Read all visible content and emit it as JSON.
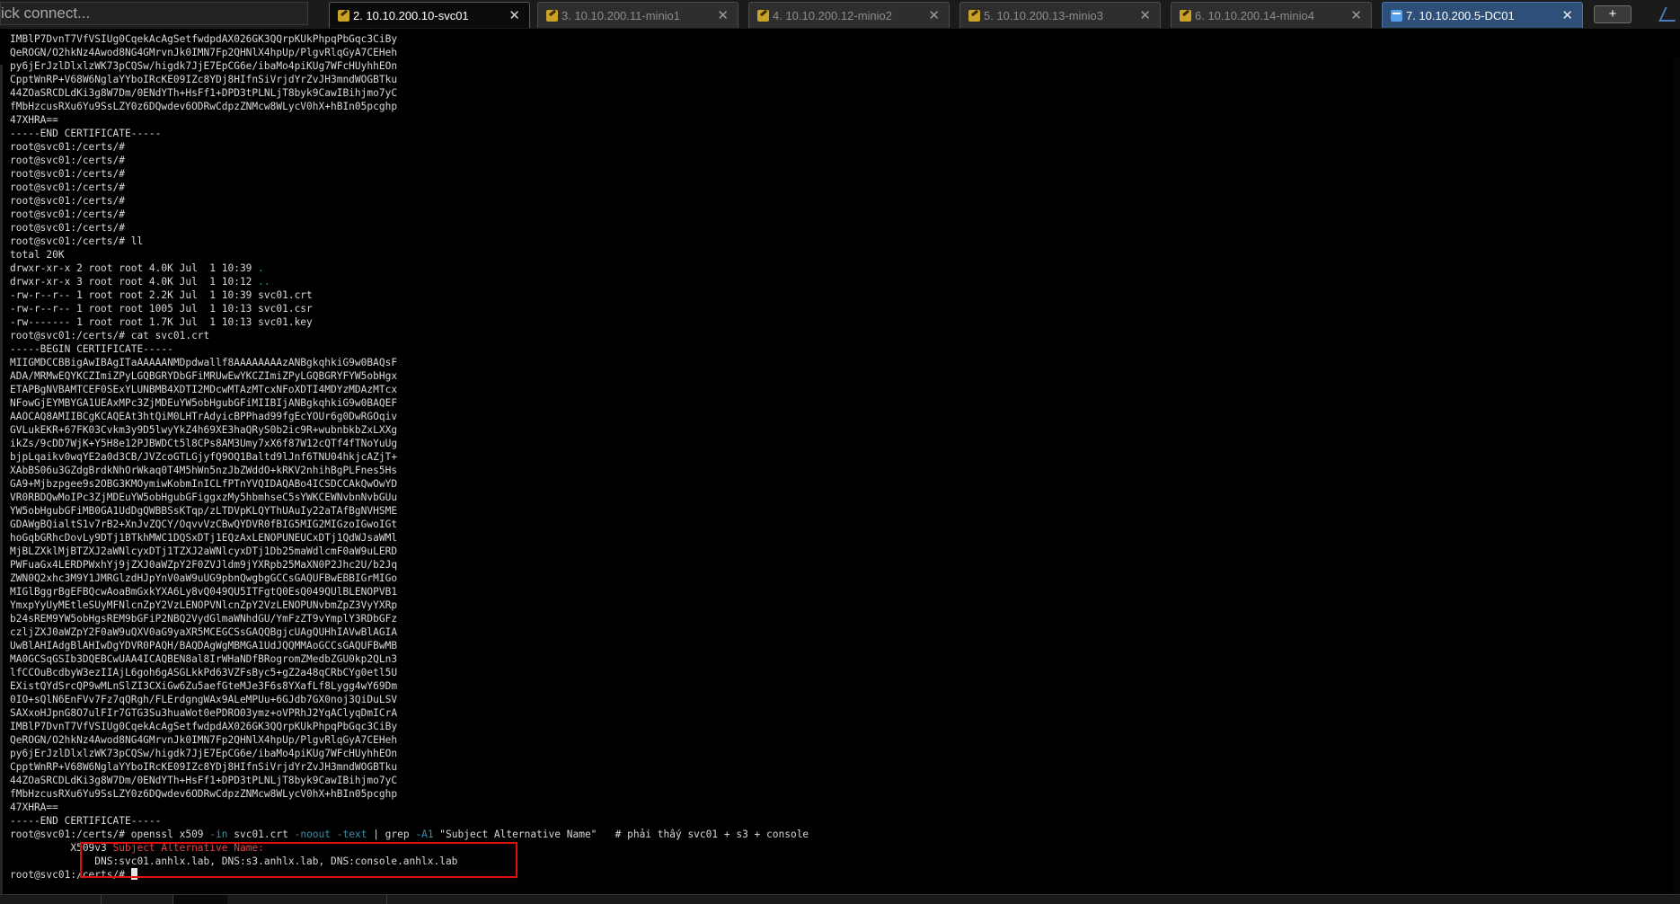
{
  "quick_connect": {
    "text": "ick connect..."
  },
  "tabs": [
    {
      "label": "2. 10.10.200.10-svc01",
      "close": "✕",
      "state": "active"
    },
    {
      "label": "3. 10.10.200.11-minio1",
      "close": "✕",
      "state": "inactive"
    },
    {
      "label": "4. 10.10.200.12-minio2",
      "close": "✕",
      "state": "inactive"
    },
    {
      "label": "5. 10.10.200.13-minio3",
      "close": "✕",
      "state": "inactive"
    },
    {
      "label": "6. 10.10.200.14-minio4",
      "close": "✕",
      "state": "inactive"
    },
    {
      "label": "7. 10.10.200.5-DC01",
      "close": "✕",
      "state": "selected"
    }
  ],
  "new_tab": {
    "label": "+"
  },
  "colors": {
    "highlight_box": "#e01010",
    "directory": "#3a8fa8",
    "option_flag": "#3a8fa8",
    "san_label": "#e04545",
    "selected_tab": "#2d4f78"
  },
  "icons": {
    "tab": "session-icon",
    "selected_tab": "rdp-icon",
    "corner": "network-icon"
  },
  "terminal": {
    "lines_top": [
      "IMBlP7DvnT7VfVSIUg0CqekAcAgSetfwdpdAX026GK3QQrpKUkPhpqPbGqc3CiBy",
      "QeROGN/O2hkNz4Awod8NG4GMrvnJk0IMN7Fp2QHNlX4hpUp/PlgvRlqGyA7CEHeh",
      "py6jErJzlDlxlzWK73pCQSw/higdk7JjE7EpCG6e/ibaMo4piKUg7WFcHUyhhEOn",
      "CpptWnRP+V68W6NglaYYboIRcKE09IZc8YDj8HIfnSiVrjdYrZvJH3mndWOGBTku",
      "44ZOaSRCDLdKi3g8W7Dm/0ENdYTh+HsFf1+DPD3tPLNLjT8byk9CawIBihjmo7yC",
      "fMbHzcusRXu6Yu9SsLZY0z6DQwdev6ODRwCdpzZNMcw8WLycV0hX+hBIn05pcghp",
      "47XHRA==",
      "-----END CERTIFICATE-----",
      "root@svc01:/certs/#",
      "root@svc01:/certs/#",
      "root@svc01:/certs/#",
      "root@svc01:/certs/#",
      "root@svc01:/certs/#",
      "root@svc01:/certs/#",
      "root@svc01:/certs/#",
      "root@svc01:/certs/# ll",
      "total 20K"
    ],
    "ls_rows": [
      {
        "text": "drwxr-xr-x 2 root root 4.0K Jul  1 10:39 ",
        "name": "."
      },
      {
        "text": "drwxr-xr-x 3 root root 4.0K Jul  1 10:12 ",
        "name": ".."
      },
      {
        "text": "-rw-r--r-- 1 root root 2.2K Jul  1 10:39 ",
        "name": "svc01.crt"
      },
      {
        "text": "-rw-r--r-- 1 root root 1005 Jul  1 10:13 ",
        "name": "svc01.csr"
      },
      {
        "text": "-rw------- 1 root root 1.7K Jul  1 10:13 ",
        "name": "svc01.key"
      }
    ],
    "lines_cert": [
      "root@svc01:/certs/# cat svc01.crt",
      "-----BEGIN CERTIFICATE-----",
      "MIIGMDCCBBigAwIBAgITaAAAAANMDpdwallf8AAAAAAAAzANBgkqhkiG9w0BAQsF",
      "ADA/MRMwEQYKCZImiZPyLGQBGRYDbGFiMRUwEwYKCZImiZPyLGQBGRYFYW5obHgx",
      "ETAPBgNVBAMTCEF0SExYLUNBMB4XDTI2MDcwMTAzMTcxNFoXDTI4MDYzMDAzMTcx",
      "NFowGjEYMBYGA1UEAxMPc3ZjMDEuYW5obHgubGFiMIIBIjANBgkqhkiG9w0BAQEF",
      "AAOCAQ8AMIIBCgKCAQEAt3htQiM0LHTrAdyicBPPhad99fgEcYOUr6g0DwRGOqiv",
      "GVLukEKR+67FK03Cvkm3y9D5lwyYkZ4h69XE3haQRyS0b2ic9R+wubnbkbZxLXXg",
      "ikZs/9cDD7WjK+Y5H8e12PJBWDCt5l8CPs8AM3Umy7xX6f87W12cQTf4fTNoYuUg",
      "bjpLqaikv0wqYE2a0d3CB/JVZcoGTLGjyfQ9OQ1Baltd9lJnf6TNU04hkjcAZjT+",
      "XAbBS06u3GZdgBrdkNhOrWkaq0T4M5hWn5nzJbZWddO+kRKV2nhihBgPLFnes5Hs",
      "GA9+Mjbzpgee9s2OBG3KMOymiwKobmInICLfPTnYVQIDAQABo4ICSDCCAkQwOwYD",
      "VR0RBDQwMoIPc3ZjMDEuYW5obHgubGFiggxzMy5hbmhseC5sYWKCEWNvbnNvbGUu",
      "YW5obHgubGFiMB0GA1UdDgQWBBSsKTqp/zLTDVpKLQYThUAuIy22aTAfBgNVHSME",
      "GDAWgBQialtS1v7rB2+XnJvZQCY/OqvvVzCBwQYDVR0fBIG5MIG2MIGzoIGwoIGt",
      "hoGqbGRhcDovLy9DTj1BTkhMWC1DQSxDTj1EQzAxLENOPUNEUCxDTj1QdWJsaWMl",
      "MjBLZXklMjBTZXJ2aWNlcyxDTj1TZXJ2aWNlcyxDTj1Db25maWdlcmF0aW9uLERD",
      "PWFuaGx4LERDPWxhYj9jZXJ0aWZpY2F0ZVJldm9jYXRpb25MaXN0P2Jhc2U/b2Jq",
      "ZWN0Q2xhc3M9Y1JMRGlzdHJpYnV0aW9uUG9pbnQwgbgGCCsGAQUFBwEBBIGrMIGo",
      "MIGlBggrBgEFBQcwAoaBmGxkYXA6Ly8vQ049QU5ITFgtQ0EsQ049QUlBLENOPVB1",
      "YmxpYyUyMEtleSUyMFNlcnZpY2VzLENOPVNlcnZpY2VzLENOPUNvbmZpZ3VyYXRp",
      "b24sREM9YW5obHgsREM9bGFiP2NBQ2VydGlmaWNhdGU/YmFzZT9vYmplY3RDbGFz",
      "czljZXJ0aWZpY2F0aW9uQXV0aG9yaXR5MCEGCSsGAQQBgjcUAgQUHhIAVwBlAGIA",
      "UwBlAHIAdgBlAHIwDgYDVR0PAQH/BAQDAgWgMBMGA1UdJQQMMAoGCCsGAQUFBwMB",
      "MA0GCSqGSIb3DQEBCwUAA4ICAQBEN8al8IrWHaNDfBRogromZMedbZGU0kp2QLn3",
      "lfCCOuBcdbyW3ezIIAjL6goh6gASGLkkPd63VZFsByc5+gZ2a48qCRbCYg0etl5U",
      "EXistQYdSrcQP9wMLnSlZI3CXiGw6Zu5aefGteMJe3F6s8YXafLf8Lygg4wY69Dm",
      "0IO+sQlN6EnFVv7Fz7qQRgh/FLErdgngWAx9ALeMPUu+6GJdb7GX0noj3QiDuLSV",
      "SAXxoHJpnG8O7ulFIr7GTG3Su3huaWot0ePDRO03ymz+oVPRhJ2YqAClyqDmICrA",
      "IMBlP7DvnT7VfVSIUg0CqekAcAgSetfwdpdAX026GK3QQrpKUkPhpqPbGqc3CiBy",
      "QeROGN/O2hkNz4Awod8NG4GMrvnJk0IMN7Fp2QHNlX4hpUp/PlgvRlqGyA7CEHeh",
      "py6jErJzlDlxlzWK73pCQSw/higdk7JjE7EpCG6e/ibaMo4piKUg7WFcHUyhhEOn",
      "CpptWnRP+V68W6NglaYYboIRcKE09IZc8YDj8HIfnSiVrjdYrZvJH3mndWOGBTku",
      "44ZOaSRCDLdKi3g8W7Dm/0ENdYTh+HsFf1+DPD3tPLNLjT8byk9CawIBihjmo7yC",
      "fMbHzcusRXu6Yu9SsLZY0z6DQwdev6ODRwCdpzZNMcw8WLycV0hX+hBIn05pcghp",
      "47XHRA==",
      "-----END CERTIFICATE-----"
    ],
    "openssl": {
      "prompt": "root@svc01:/certs/# ",
      "cmd1": "openssl x509 ",
      "opt1": "-in",
      "cmd2": " svc01.crt ",
      "opt2": "-noout",
      "sp1": " ",
      "opt3": "-text",
      "cmd3": " | grep ",
      "opt4": "-A1",
      "cmd4": " \"Subject Alternative Name\"   # phải thấy svc01 + s3 + console"
    },
    "san": {
      "prefix": "          X509v3 ",
      "label": "Subject Alternative Name:",
      "values": "              DNS:svc01.anhlx.lab, DNS:s3.anhlx.lab, DNS:console.anhlx.lab"
    },
    "final_prompt": "root@svc01:/certs/# "
  }
}
